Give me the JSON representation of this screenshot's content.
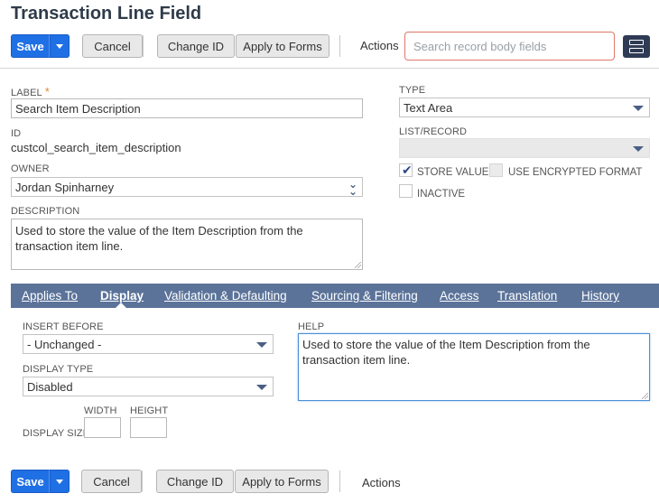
{
  "page": {
    "title": "Transaction Line Field"
  },
  "toolbar": {
    "save_label": "Save",
    "cancel_label": "Cancel",
    "change_id_label": "Change ID",
    "apply_to_forms_label": "Apply to Forms",
    "actions_label": "Actions"
  },
  "search": {
    "placeholder": "Search record body fields"
  },
  "fields": {
    "label": {
      "label": "LABEL",
      "required_mark": "*",
      "value": "Search Item Description"
    },
    "id": {
      "label": "ID",
      "value": "custcol_search_item_description"
    },
    "owner": {
      "label": "OWNER",
      "value": "Jordan Spinharney"
    },
    "description": {
      "label": "DESCRIPTION",
      "value": "Used to store the value of the Item Description from the transaction item line."
    },
    "type": {
      "label": "TYPE",
      "value": "Text Area"
    },
    "list_record": {
      "label": "LIST/RECORD",
      "value": ""
    },
    "store_value": {
      "label": "STORE VALUE",
      "checked": true
    },
    "use_encrypted_format": {
      "label": "USE ENCRYPTED FORMAT",
      "checked": false
    },
    "inactive": {
      "label": "INACTIVE",
      "checked": false
    }
  },
  "tabs": [
    {
      "label": "Applies To",
      "active": false
    },
    {
      "label": "Display",
      "active": true
    },
    {
      "label": "Validation & Defaulting",
      "active": false
    },
    {
      "label": "Sourcing & Filtering",
      "active": false
    },
    {
      "label": "Access",
      "active": false
    },
    {
      "label": "Translation",
      "active": false
    },
    {
      "label": "History",
      "active": false
    }
  ],
  "display_tab": {
    "insert_before": {
      "label": "INSERT BEFORE",
      "value": "- Unchanged -"
    },
    "display_type": {
      "label": "DISPLAY TYPE",
      "value": "Disabled"
    },
    "display_size": {
      "label": "DISPLAY SIZE",
      "width_label": "WIDTH",
      "height_label": "HEIGHT",
      "width": "",
      "height": ""
    },
    "help": {
      "label": "HELP",
      "value": "Used to store the value of the Item Description from the transaction item line."
    }
  },
  "colors": {
    "primary": "#1f6fe5",
    "tabbar": "#5b7399",
    "title": "#2f3b4a"
  }
}
